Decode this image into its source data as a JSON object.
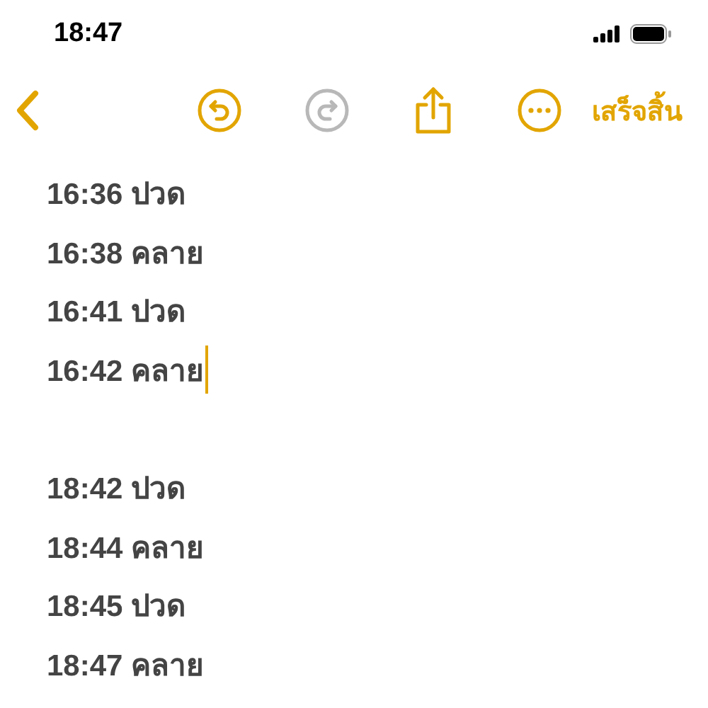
{
  "status_bar": {
    "time": "18:47"
  },
  "toolbar": {
    "undo_disabled": false,
    "redo_disabled": true,
    "done": "เสร็จสิ้น"
  },
  "note": {
    "groups": [
      {
        "lines": [
          {
            "text": "16:36 ปวด",
            "caret": false
          },
          {
            "text": "16:38 คลาย",
            "caret": false
          },
          {
            "text": "16:41 ปวด",
            "caret": false
          },
          {
            "text": "16:42 คลาย",
            "caret": true
          }
        ]
      },
      {
        "lines": [
          {
            "text": "18:42 ปวด",
            "caret": false
          },
          {
            "text": "18:44 คลาย",
            "caret": false
          },
          {
            "text": "18:45 ปวด",
            "caret": false
          },
          {
            "text": "18:47 คลาย",
            "caret": false
          }
        ]
      }
    ]
  }
}
